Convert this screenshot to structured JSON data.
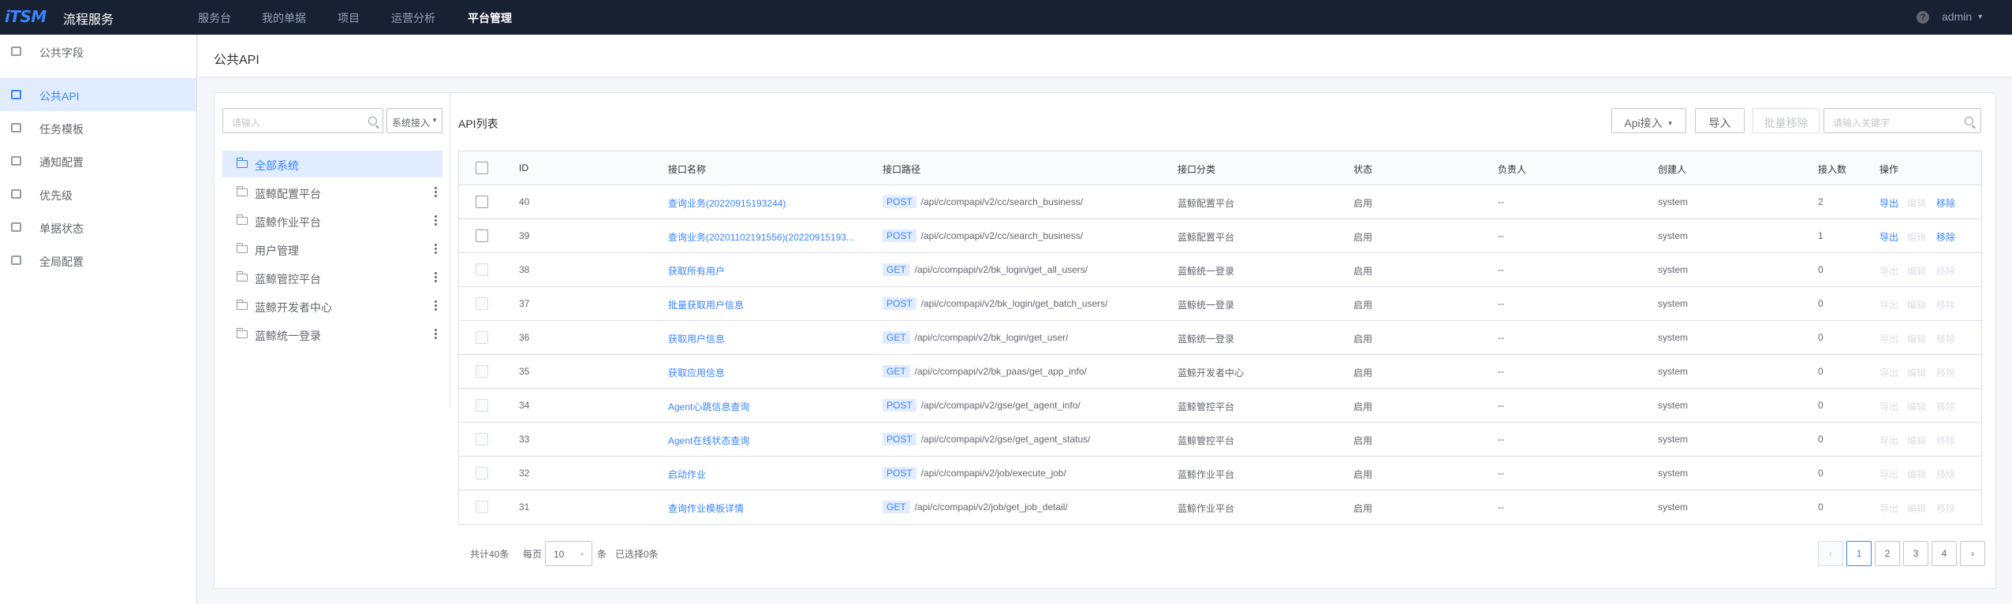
{
  "app": {
    "logo": "iTSM",
    "title": "流程服务"
  },
  "nav": {
    "items": [
      "服务台",
      "我的单据",
      "项目",
      "运营分析",
      "平台管理"
    ],
    "active_index": 4,
    "help": "?",
    "user": "admin"
  },
  "sidebar": {
    "items": [
      "公共字段",
      "公共API",
      "任务模板",
      "通知配置",
      "优先级",
      "单据状态",
      "全局配置"
    ],
    "active_index": 1
  },
  "page": {
    "title": "公共API"
  },
  "tree": {
    "search_placeholder": "请输入",
    "system_button": "系统接入",
    "items": [
      "全部系统",
      "蓝鲸配置平台",
      "蓝鲸作业平台",
      "用户管理",
      "蓝鲸管控平台",
      "蓝鲸开发者中心",
      "蓝鲸统一登录"
    ]
  },
  "list": {
    "title": "API列表",
    "api_button": "Api接入",
    "import_button": "导入",
    "batch_remove_button": "批量移除",
    "search_placeholder": "请输入关键字",
    "columns": [
      "ID",
      "接口名称",
      "接口路径",
      "接口分类",
      "状态",
      "负责人",
      "创建人",
      "接入数",
      "操作"
    ],
    "actions": [
      "导出",
      "编辑",
      "移除"
    ],
    "rows": [
      {
        "id": "40",
        "name": "查询业务(20220915193244)",
        "method": "POST",
        "path": "/api/c/compapi/v2/cc/search_business/",
        "category": "蓝鲸配置平台",
        "status": "启用",
        "owner": "--",
        "creator": "system",
        "count": "2",
        "enabled": true
      },
      {
        "id": "39",
        "name": "查询业务(20201102191556)(20220915193...",
        "method": "POST",
        "path": "/api/c/compapi/v2/cc/search_business/",
        "category": "蓝鲸配置平台",
        "status": "启用",
        "owner": "--",
        "creator": "system",
        "count": "1",
        "enabled": true
      },
      {
        "id": "38",
        "name": "获取所有用户",
        "method": "GET",
        "path": "/api/c/compapi/v2/bk_login/get_all_users/",
        "category": "蓝鲸统一登录",
        "status": "启用",
        "owner": "--",
        "creator": "system",
        "count": "0",
        "enabled": false
      },
      {
        "id": "37",
        "name": "批量获取用户信息",
        "method": "POST",
        "path": "/api/c/compapi/v2/bk_login/get_batch_users/",
        "category": "蓝鲸统一登录",
        "status": "启用",
        "owner": "--",
        "creator": "system",
        "count": "0",
        "enabled": false
      },
      {
        "id": "36",
        "name": "获取用户信息",
        "method": "GET",
        "path": "/api/c/compapi/v2/bk_login/get_user/",
        "category": "蓝鲸统一登录",
        "status": "启用",
        "owner": "--",
        "creator": "system",
        "count": "0",
        "enabled": false
      },
      {
        "id": "35",
        "name": "获取应用信息",
        "method": "GET",
        "path": "/api/c/compapi/v2/bk_paas/get_app_info/",
        "category": "蓝鲸开发者中心",
        "status": "启用",
        "owner": "--",
        "creator": "system",
        "count": "0",
        "enabled": false
      },
      {
        "id": "34",
        "name": "Agent心跳信息查询",
        "method": "POST",
        "path": "/api/c/compapi/v2/gse/get_agent_info/",
        "category": "蓝鲸管控平台",
        "status": "启用",
        "owner": "--",
        "creator": "system",
        "count": "0",
        "enabled": false
      },
      {
        "id": "33",
        "name": "Agent在线状态查询",
        "method": "POST",
        "path": "/api/c/compapi/v2/gse/get_agent_status/",
        "category": "蓝鲸管控平台",
        "status": "启用",
        "owner": "--",
        "creator": "system",
        "count": "0",
        "enabled": false
      },
      {
        "id": "32",
        "name": "启动作业",
        "method": "POST",
        "path": "/api/c/compapi/v2/job/execute_job/",
        "category": "蓝鲸作业平台",
        "status": "启用",
        "owner": "--",
        "creator": "system",
        "count": "0",
        "enabled": false
      },
      {
        "id": "31",
        "name": "查询作业模板详情",
        "method": "GET",
        "path": "/api/c/compapi/v2/job/get_job_detail/",
        "category": "蓝鲸作业平台",
        "status": "启用",
        "owner": "--",
        "creator": "system",
        "count": "0",
        "enabled": false
      }
    ]
  },
  "pagination": {
    "total": "共计40条",
    "per_page_label": "每页",
    "per_page": "10",
    "unit": "条",
    "selected": "已选择0条",
    "prev": "‹",
    "next": "›",
    "pages": [
      "1",
      "2",
      "3",
      "4"
    ],
    "current": "1"
  },
  "colors": {
    "primary": "#3a84ff",
    "nav_bg": "#182132",
    "active_bg": "#e1ecff"
  }
}
